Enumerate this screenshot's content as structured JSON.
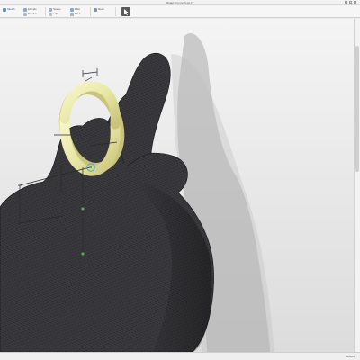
{
  "window": {
    "title": "Model ring mesh.prt.jt *"
  },
  "ribbon": {
    "items": [
      {
        "label": "Sketch",
        "icon": "sketch-icon",
        "color": "#6b8fb5"
      },
      {
        "label": "Extrude",
        "icon": "extrude-icon",
        "color": "#8aa8c6"
      },
      {
        "label": "Revolve",
        "icon": "revolve-icon",
        "color": "#a8b8c8"
      },
      {
        "label": "Sweep",
        "icon": "sweep-icon",
        "color": "#9bb0c2"
      },
      {
        "label": "Loft",
        "icon": "loft-icon",
        "color": "#b3c0cc"
      },
      {
        "label": "Fillet",
        "icon": "fillet-icon",
        "color": "#8fa6bd"
      },
      {
        "label": "Shell",
        "icon": "shell-icon",
        "color": "#a1b4c6"
      },
      {
        "label": "Mesh",
        "icon": "mesh-icon",
        "color": "#7d97b1"
      }
    ],
    "active_tool_icon": "select-tool-icon"
  },
  "colors": {
    "background_top": "#f4f4f4",
    "background_bottom": "#dcdcdc",
    "mesh_fill": "#3d3d41",
    "mesh_line": "#1f1f22",
    "ring": "#e9e7a6",
    "ring_shadow": "#c8c47c",
    "annotation": "#2a2a2a",
    "selection": "#3aa0d8"
  },
  "status": {
    "units": "MMGS"
  }
}
